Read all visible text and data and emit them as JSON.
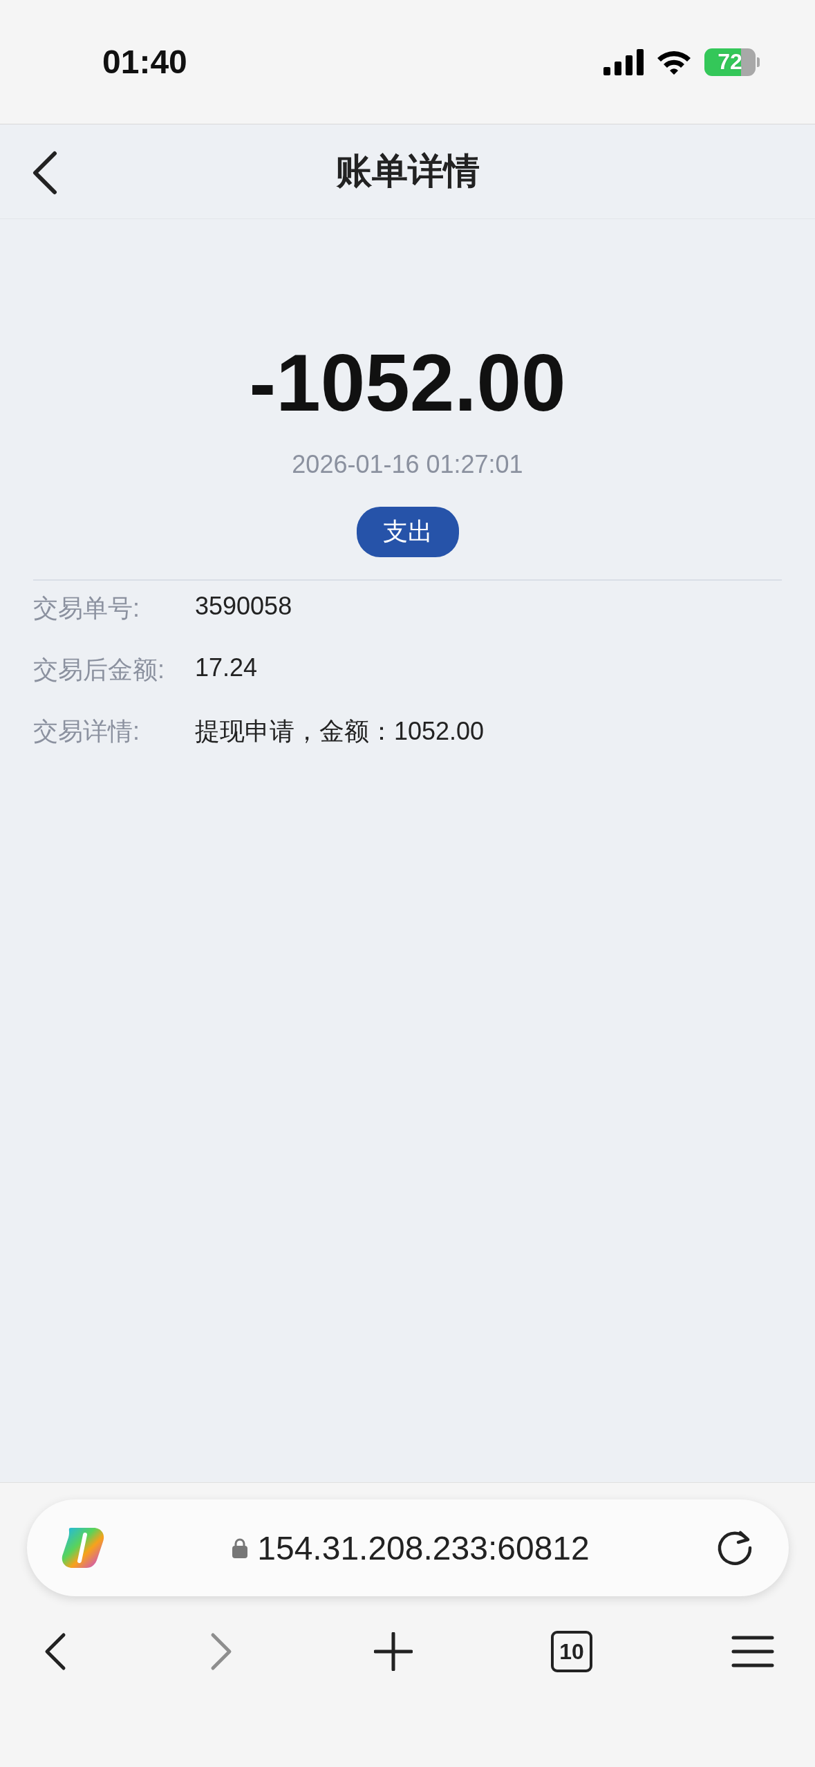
{
  "status_bar": {
    "time": "01:40",
    "battery": "72"
  },
  "header": {
    "title": "账单详情"
  },
  "bill": {
    "amount": "-1052.00",
    "datetime": "2026-01-16 01:27:01",
    "type_badge": "支出",
    "details": [
      {
        "label": "交易单号:",
        "value": "3590058"
      },
      {
        "label": "交易后金额:",
        "value": "17.24"
      },
      {
        "label": "交易详情:",
        "value": "提现申请，金额：1052.00"
      }
    ]
  },
  "browser": {
    "url": "154.31.208.233:60812",
    "tab_count": "10",
    "nav": [
      {
        "kind": "back",
        "disabled": false
      },
      {
        "kind": "forward",
        "disabled": true
      },
      {
        "kind": "new-tab",
        "disabled": false
      },
      {
        "kind": "tabs",
        "disabled": false
      },
      {
        "kind": "menu",
        "disabled": false
      }
    ]
  }
}
